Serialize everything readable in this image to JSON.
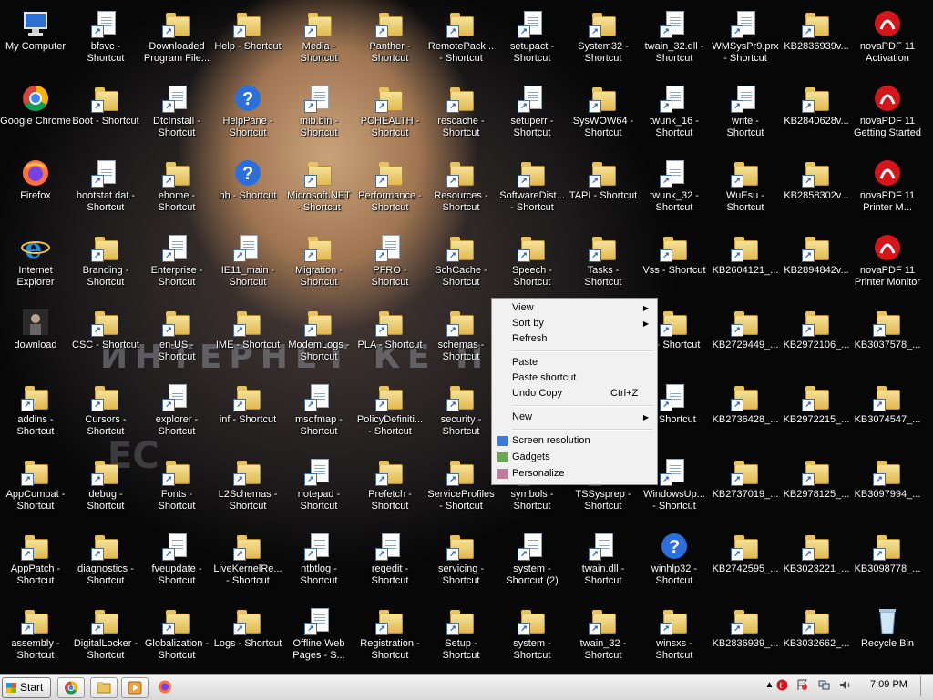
{
  "desktop": {
    "banner_text": "ИНТЕРНЕТ КЕ ПИМЕН",
    "icons": [
      {
        "label": "My Computer",
        "type": "computer"
      },
      {
        "label": "bfsvc -\nShortcut",
        "type": "file"
      },
      {
        "label": "Downloaded\nProgram File...",
        "type": "folder"
      },
      {
        "label": "Help - Shortcut",
        "type": "folder"
      },
      {
        "label": "Media -\nShortcut",
        "type": "folder"
      },
      {
        "label": "Panther -\nShortcut",
        "type": "folder"
      },
      {
        "label": "RemotePack...\n- Shortcut",
        "type": "folder"
      },
      {
        "label": "setupact -\nShortcut",
        "type": "file"
      },
      {
        "label": "System32 -\nShortcut",
        "type": "folder"
      },
      {
        "label": "twain_32.dll -\nShortcut",
        "type": "file"
      },
      {
        "label": "WMSysPr9.prx\n- Shortcut",
        "type": "file"
      },
      {
        "label": "KB2836939v...",
        "type": "folder"
      },
      {
        "label": "novaPDF 11\nActivation",
        "type": "nova"
      },
      {
        "label": "Google Chrome",
        "type": "chrome"
      },
      {
        "label": "Boot - Shortcut",
        "type": "folder"
      },
      {
        "label": "DtcInstall -\nShortcut",
        "type": "file"
      },
      {
        "label": "HelpPane -\nShortcut",
        "type": "help"
      },
      {
        "label": "mib.bin -\nShortcut",
        "type": "file"
      },
      {
        "label": "PCHEALTH -\nShortcut",
        "type": "folder"
      },
      {
        "label": "rescache -\nShortcut",
        "type": "folder"
      },
      {
        "label": "setuperr -\nShortcut",
        "type": "file"
      },
      {
        "label": "SysWOW64 -\nShortcut",
        "type": "folder"
      },
      {
        "label": "twunk_16 -\nShortcut",
        "type": "file"
      },
      {
        "label": "write -\nShortcut",
        "type": "file"
      },
      {
        "label": "KB2840628v...",
        "type": "folder"
      },
      {
        "label": "novaPDF 11\nGetting Started",
        "type": "nova"
      },
      {
        "label": "Firefox",
        "type": "firefox"
      },
      {
        "label": "bootstat.dat -\nShortcut",
        "type": "file"
      },
      {
        "label": "ehome -\nShortcut",
        "type": "folder"
      },
      {
        "label": "hh - Shortcut",
        "type": "help"
      },
      {
        "label": "Microsoft.NET\n- Shortcut",
        "type": "folder"
      },
      {
        "label": "Performance -\nShortcut",
        "type": "folder"
      },
      {
        "label": "Resources -\nShortcut",
        "type": "folder"
      },
      {
        "label": "SoftwareDist...\n- Shortcut",
        "type": "folder"
      },
      {
        "label": "TAPI - Shortcut",
        "type": "folder"
      },
      {
        "label": "twunk_32 -\nShortcut",
        "type": "file"
      },
      {
        "label": "WuEsu -\nShortcut",
        "type": "folder"
      },
      {
        "label": "KB2858302v...",
        "type": "folder"
      },
      {
        "label": "novaPDF 11\nPrinter M...",
        "type": "nova"
      },
      {
        "label": "Internet\nExplorer",
        "type": "ie"
      },
      {
        "label": "Branding -\nShortcut",
        "type": "folder"
      },
      {
        "label": "Enterprise -\nShortcut",
        "type": "file"
      },
      {
        "label": "IE11_main -\nShortcut",
        "type": "file"
      },
      {
        "label": "Migration -\nShortcut",
        "type": "folder"
      },
      {
        "label": "PFRO -\nShortcut",
        "type": "file"
      },
      {
        "label": "SchCache -\nShortcut",
        "type": "folder"
      },
      {
        "label": "Speech -\nShortcut",
        "type": "folder"
      },
      {
        "label": "Tasks -\nShortcut",
        "type": "folder"
      },
      {
        "label": "Vss - Shortcut",
        "type": "folder"
      },
      {
        "label": "KB2604121_...",
        "type": "folder"
      },
      {
        "label": "KB2894842v...",
        "type": "folder"
      },
      {
        "label": "novaPDF 11\nPrinter Monitor",
        "type": "nova"
      },
      {
        "label": "download",
        "type": "person"
      },
      {
        "label": "CSC - Shortcut",
        "type": "folder"
      },
      {
        "label": "en-US -\nShortcut",
        "type": "folder"
      },
      {
        "label": "IME - Shortcut",
        "type": "folder"
      },
      {
        "label": "ModemLogs -\nShortcut",
        "type": "folder"
      },
      {
        "label": "PLA - Shortcut",
        "type": "folder"
      },
      {
        "label": "schemas -\nShortcut",
        "type": "folder"
      },
      {
        "label": "p - Shortcut",
        "type": "folder"
      },
      {
        "label": "KB2729449_...",
        "type": "folder"
      },
      {
        "label": "KB2972106_...",
        "type": "folder"
      },
      {
        "label": "KB3037578_...",
        "type": "folder"
      },
      {
        "label": "addins -\nShortcut",
        "type": "folder"
      },
      {
        "label": "Cursors -\nShortcut",
        "type": "folder"
      },
      {
        "label": "explorer -\nShortcut",
        "type": "file"
      },
      {
        "label": "inf - Shortcut",
        "type": "folder"
      },
      {
        "label": "msdfmap -\nShortcut",
        "type": "file"
      },
      {
        "label": "PolicyDefiniti...\n- Shortcut",
        "type": "folder"
      },
      {
        "label": "security -\nShortcut",
        "type": "folder"
      },
      {
        "label": "- Shortcut",
        "type": "file"
      },
      {
        "label": "KB2736428_...",
        "type": "folder"
      },
      {
        "label": "KB2972215_...",
        "type": "folder"
      },
      {
        "label": "KB3074547_...",
        "type": "folder"
      },
      {
        "label": "AppCompat -\nShortcut",
        "type": "folder"
      },
      {
        "label": "debug -\nShortcut",
        "type": "folder"
      },
      {
        "label": "Fonts -\nShortcut",
        "type": "folder"
      },
      {
        "label": "L2Schemas -\nShortcut",
        "type": "folder"
      },
      {
        "label": "notepad -\nShortcut",
        "type": "file"
      },
      {
        "label": "Prefetch -\nShortcut",
        "type": "folder"
      },
      {
        "label": "ServiceProfiles\n- Shortcut",
        "type": "folder"
      },
      {
        "label": "symbols -\nShortcut",
        "type": "folder"
      },
      {
        "label": "TSSysprep -\nShortcut",
        "type": "folder"
      },
      {
        "label": "WindowsUp...\n- Shortcut",
        "type": "file"
      },
      {
        "label": "KB2737019_...",
        "type": "folder"
      },
      {
        "label": "KB2978125_...",
        "type": "folder"
      },
      {
        "label": "KB3097994_...",
        "type": "folder"
      },
      {
        "label": "AppPatch -\nShortcut",
        "type": "folder"
      },
      {
        "label": "diagnostics -\nShortcut",
        "type": "folder"
      },
      {
        "label": "fveupdate -\nShortcut",
        "type": "file"
      },
      {
        "label": "LiveKernelRe...\n- Shortcut",
        "type": "folder"
      },
      {
        "label": "ntbtlog -\nShortcut",
        "type": "file"
      },
      {
        "label": "regedit -\nShortcut",
        "type": "file"
      },
      {
        "label": "servicing -\nShortcut",
        "type": "folder"
      },
      {
        "label": "system -\nShortcut (2)",
        "type": "file"
      },
      {
        "label": "twain.dll -\nShortcut",
        "type": "file"
      },
      {
        "label": "winhlp32 -\nShortcut",
        "type": "help"
      },
      {
        "label": "KB2742595_...",
        "type": "folder"
      },
      {
        "label": "KB3023221_...",
        "type": "folder"
      },
      {
        "label": "KB3098778_...",
        "type": "folder"
      },
      {
        "label": "assembly -\nShortcut",
        "type": "folder"
      },
      {
        "label": "DigitalLocker -\nShortcut",
        "type": "folder"
      },
      {
        "label": "Globalization -\nShortcut",
        "type": "folder"
      },
      {
        "label": "Logs - Shortcut",
        "type": "folder"
      },
      {
        "label": "Offline Web\nPages - S...",
        "type": "file"
      },
      {
        "label": "Registration -\nShortcut",
        "type": "folder"
      },
      {
        "label": "Setup -\nShortcut",
        "type": "folder"
      },
      {
        "label": "system -\nShortcut",
        "type": "folder"
      },
      {
        "label": "twain_32 -\nShortcut",
        "type": "folder"
      },
      {
        "label": "winsxs -\nShortcut",
        "type": "folder"
      },
      {
        "label": "KB2836939_...",
        "type": "folder"
      },
      {
        "label": "KB3032662_...",
        "type": "folder"
      },
      {
        "label": "Recycle Bin",
        "type": "recycle"
      }
    ]
  },
  "context_menu": {
    "items": [
      {
        "label": "View",
        "submenu": true
      },
      {
        "label": "Sort by",
        "submenu": true
      },
      {
        "label": "Refresh"
      },
      {
        "separator": true
      },
      {
        "label": "Paste"
      },
      {
        "label": "Paste shortcut"
      },
      {
        "label": "Undo Copy",
        "shortcut": "Ctrl+Z"
      },
      {
        "separator": true
      },
      {
        "label": "New",
        "submenu": true
      },
      {
        "separator": true
      },
      {
        "label": "Screen resolution",
        "icon": "screen-resolution-icon"
      },
      {
        "label": "Gadgets",
        "icon": "gadgets-icon"
      },
      {
        "label": "Personalize",
        "icon": "personalize-icon"
      }
    ]
  },
  "taskbar": {
    "start_label": "Start",
    "pinned": [
      "chrome-icon",
      "explorer-folder-icon",
      "media-player-icon",
      "firefox-icon"
    ],
    "tray_icons": [
      "show-hidden-icon",
      "novapdf-tray-icon",
      "action-center-icon",
      "network-icon",
      "volume-icon"
    ],
    "clock": "7:09 PM"
  }
}
